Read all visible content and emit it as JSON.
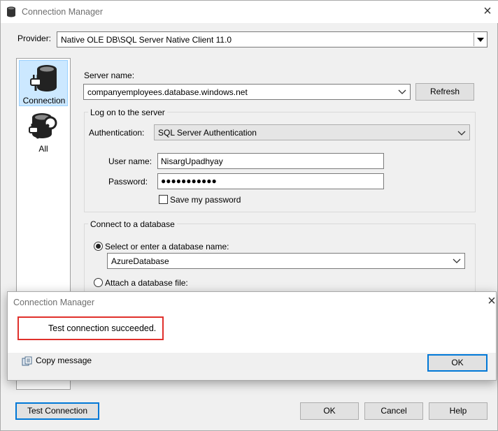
{
  "window": {
    "title": "Connection Manager",
    "close_glyph": "×"
  },
  "provider": {
    "label": "Provider:",
    "value": "Native OLE DB\\SQL Server Native Client 11.0"
  },
  "sidebar": {
    "items": [
      {
        "label": "Connection",
        "icon": "database-plug-icon",
        "selected": true
      },
      {
        "label": "All",
        "icon": "database-wrench-icon",
        "selected": false
      }
    ]
  },
  "server": {
    "label": "Server name:",
    "value": "companyemployees.database.windows.net",
    "refresh_label": "Refresh"
  },
  "logon": {
    "group_title": "Log on to the server",
    "auth_label": "Authentication:",
    "auth_value": "SQL Server Authentication",
    "user_label": "User name:",
    "user_value": "NisargUpadhyay",
    "password_label": "Password:",
    "password_value": "●●●●●●●●●●●",
    "save_password_label": "Save my password",
    "save_password_checked": false
  },
  "database": {
    "group_title": "Connect to a database",
    "select_radio_label": "Select or enter a database name:",
    "database_value": "AzureDatabase",
    "attach_radio_label": "Attach a database file:"
  },
  "popup": {
    "title": "Connection Manager",
    "close_glyph": "×",
    "message": "Test connection succeeded.",
    "copy_label": "Copy message",
    "ok_label": "OK",
    "highlight_color": "#e0302c"
  },
  "footer": {
    "test_label": "Test Connection",
    "ok_label": "OK",
    "cancel_label": "Cancel",
    "help_label": "Help"
  },
  "colors": {
    "accent": "#0078d7",
    "selection": "#cce8ff"
  }
}
